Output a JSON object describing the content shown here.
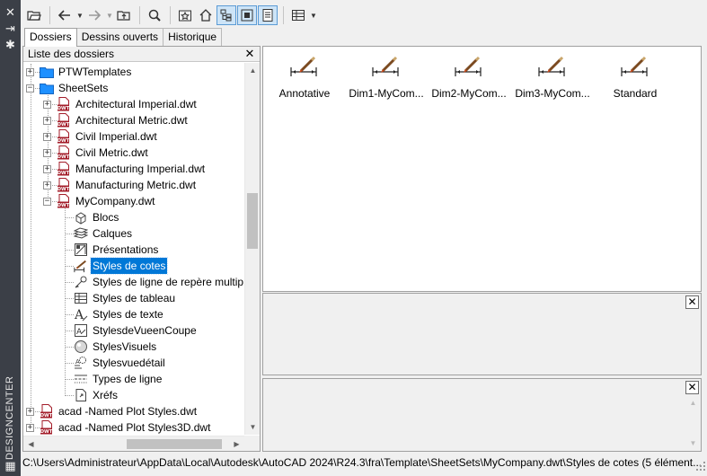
{
  "palette": {
    "title": "DESIGNCENTER",
    "close_glyph": "✕",
    "autohide_glyph": "⇥",
    "properties_glyph": "✱",
    "menu_glyph": "▦"
  },
  "toolbar": {
    "buttons": [
      "load-icon",
      "back-icon",
      "forward-icon",
      "up-icon",
      "search-icon",
      "favorites-icon",
      "home-icon",
      "tree-toggle-icon",
      "preview-toggle-icon",
      "description-toggle-icon",
      "views-icon"
    ]
  },
  "tabs": [
    {
      "label": "Dossiers",
      "active": true
    },
    {
      "label": "Dessins ouverts",
      "active": false
    },
    {
      "label": "Historique",
      "active": false
    }
  ],
  "tree": {
    "header": "Liste des dossiers",
    "close": "✕",
    "items": [
      {
        "label": "PTWTemplates",
        "type": "folder",
        "expander": "+"
      },
      {
        "label": "SheetSets",
        "type": "folder",
        "expander": "−"
      },
      {
        "label": "Architectural Imperial.dwt",
        "type": "dwt",
        "expander": "+"
      },
      {
        "label": "Architectural Metric.dwt",
        "type": "dwt",
        "expander": "+"
      },
      {
        "label": "Civil Imperial.dwt",
        "type": "dwt",
        "expander": "+"
      },
      {
        "label": "Civil Metric.dwt",
        "type": "dwt",
        "expander": "+"
      },
      {
        "label": "Manufacturing Imperial.dwt",
        "type": "dwt",
        "expander": "+"
      },
      {
        "label": "Manufacturing Metric.dwt",
        "type": "dwt",
        "expander": "+"
      },
      {
        "label": "MyCompany.dwt",
        "type": "dwt",
        "expander": "−"
      },
      {
        "label": "Blocs",
        "type": "blocks"
      },
      {
        "label": "Calques",
        "type": "layers"
      },
      {
        "label": "Présentations",
        "type": "layouts"
      },
      {
        "label": "Styles de cotes",
        "type": "dimstyle",
        "selected": true
      },
      {
        "label": "Styles de ligne de repère multip",
        "type": "mleader"
      },
      {
        "label": "Styles de tableau",
        "type": "table"
      },
      {
        "label": "Styles de texte",
        "type": "text"
      },
      {
        "label": "StylesdeVueenCoupe",
        "type": "section"
      },
      {
        "label": "StylesVisuels",
        "type": "visual"
      },
      {
        "label": "Stylesvuedétail",
        "type": "detail"
      },
      {
        "label": "Types de ligne",
        "type": "linetype"
      },
      {
        "label": "Xréfs",
        "type": "xref"
      },
      {
        "label": "acad -Named Plot Styles.dwt",
        "type": "dwt",
        "expander": "+"
      },
      {
        "label": "acad -Named Plot Styles3D.dwt",
        "type": "dwt",
        "expander": "+"
      }
    ]
  },
  "content": {
    "items": [
      {
        "label": "Annotative"
      },
      {
        "label": "Dim1-MyCom..."
      },
      {
        "label": "Dim2-MyCom..."
      },
      {
        "label": "Dim3-MyCom..."
      },
      {
        "label": "Standard"
      }
    ]
  },
  "preview": {
    "close": "✕"
  },
  "description": {
    "close": "✕"
  },
  "status": {
    "path": "C:\\Users\\Administrateur\\AppData\\Local\\Autodesk\\AutoCAD 2024\\R24.3\\fra\\Template\\SheetSets\\MyCompany.dwt\\Styles de cotes (5 élément..."
  },
  "colors": {
    "palette_bar": "#3b3f47",
    "selection": "#0078d7",
    "folder": "#1e90ff",
    "dwt_red": "#a31d2a"
  }
}
